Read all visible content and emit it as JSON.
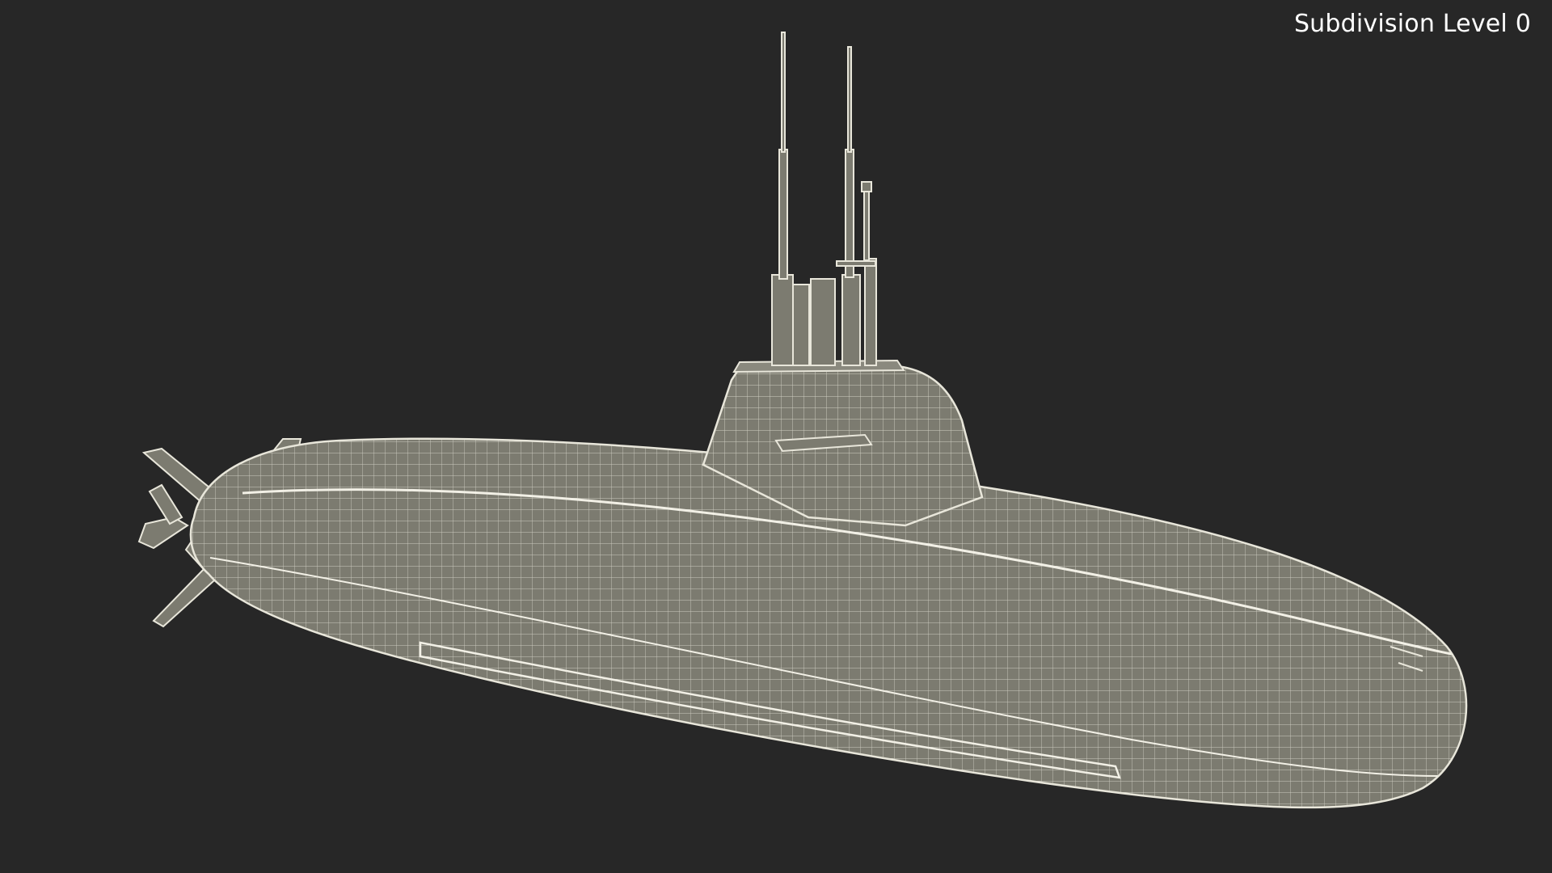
{
  "viewport": {
    "subdivision_label": "Subdivision Level 0",
    "background_color": "#272727"
  },
  "model": {
    "render_mode": "wireframe",
    "surface_color": "#7c7b70",
    "wire_color": "#e8e6da",
    "icon": "submarine-wireframe-icon"
  }
}
